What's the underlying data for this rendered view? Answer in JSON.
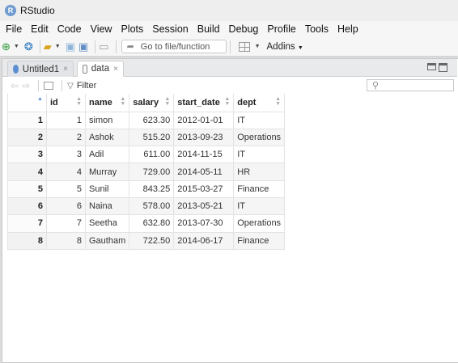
{
  "window": {
    "title": "RStudio"
  },
  "menu": [
    "File",
    "Edit",
    "Code",
    "View",
    "Plots",
    "Session",
    "Build",
    "Debug",
    "Profile",
    "Tools",
    "Help"
  ],
  "toolbar": {
    "goto_label": "Go to file/function",
    "addins_label": "Addins"
  },
  "tabs": [
    {
      "label": "Untitled1",
      "close": "×"
    },
    {
      "label": "data",
      "close": "×"
    }
  ],
  "filterbar": {
    "filter_label": "Filter"
  },
  "table": {
    "columns": [
      "",
      "id",
      "name",
      "salary",
      "start_date",
      "dept"
    ],
    "rows": [
      {
        "row": "1",
        "id": "1",
        "name": "simon",
        "salary": "623.30",
        "start_date": "2012-01-01",
        "dept": "IT"
      },
      {
        "row": "2",
        "id": "2",
        "name": "Ashok",
        "salary": "515.20",
        "start_date": "2013-09-23",
        "dept": "Operations"
      },
      {
        "row": "3",
        "id": "3",
        "name": "Adil",
        "salary": "611.00",
        "start_date": "2014-11-15",
        "dept": "IT"
      },
      {
        "row": "4",
        "id": "4",
        "name": "Murray",
        "salary": "729.00",
        "start_date": "2014-05-11",
        "dept": "HR"
      },
      {
        "row": "5",
        "id": "5",
        "name": "Sunil",
        "salary": "843.25",
        "start_date": "2015-03-27",
        "dept": "Finance"
      },
      {
        "row": "6",
        "id": "6",
        "name": "Naina",
        "salary": "578.00",
        "start_date": "2013-05-21",
        "dept": "IT"
      },
      {
        "row": "7",
        "id": "7",
        "name": "Seetha",
        "salary": "632.80",
        "start_date": "2013-07-30",
        "dept": "Operations"
      },
      {
        "row": "8",
        "id": "8",
        "name": "Gautham",
        "salary": "722.50",
        "start_date": "2014-06-17",
        "dept": "Finance"
      }
    ]
  }
}
